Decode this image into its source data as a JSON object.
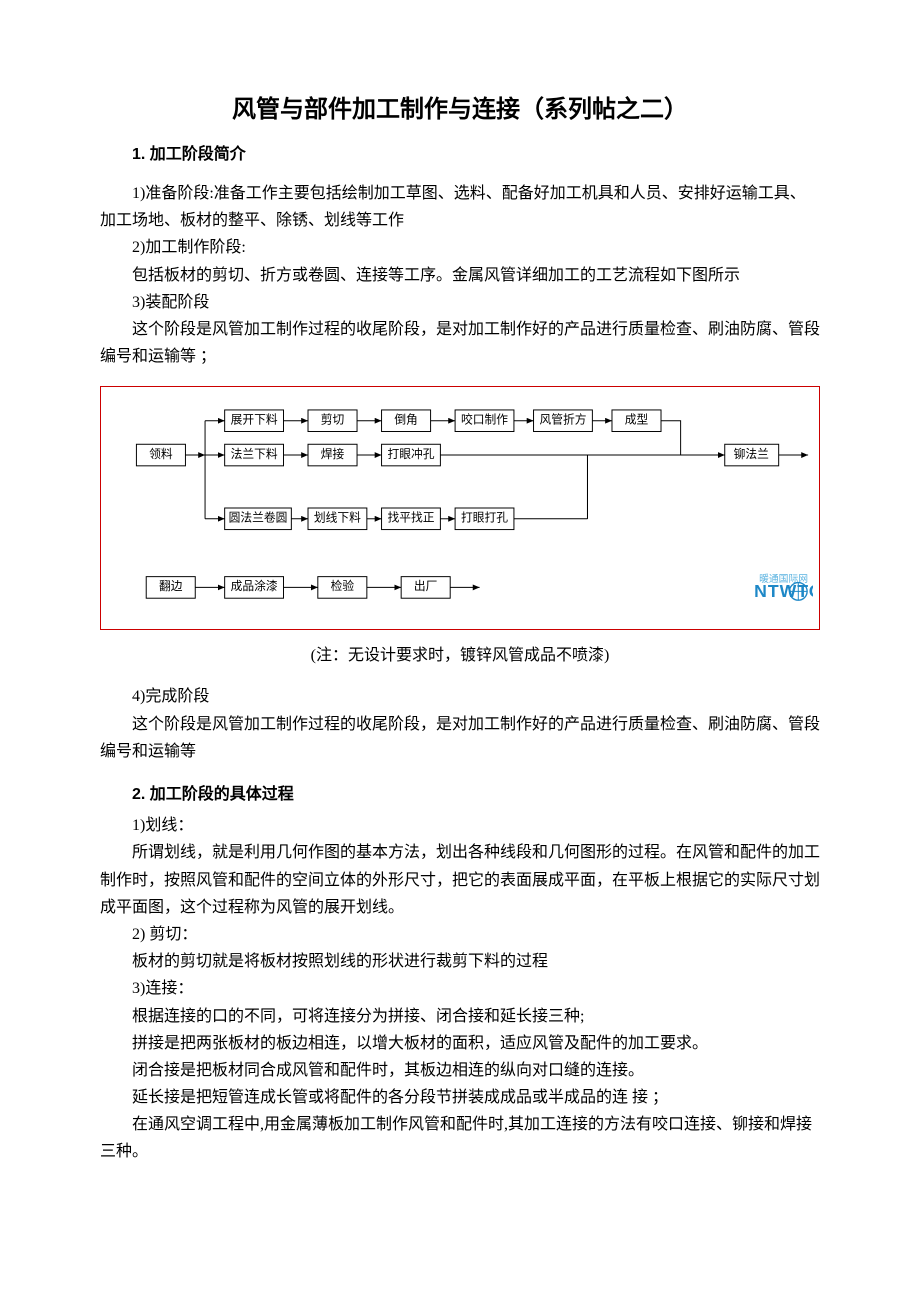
{
  "title": "风管与部件加工制作与连接（系列帖之二）",
  "s1": {
    "heading": "1. 加工阶段简介",
    "p1": "1)准备阶段:准备工作主要包括绘制加工草图、选料、配备好加工机具和人员、安排好运输工具、加工场地、板材的整平、除锈、划线等工作",
    "p2": "2)加工制作阶段:",
    "p3": "包括板材的剪切、折方或卷圆、连接等工序。金属风管详细加工的工艺流程如下图所示",
    "p4": "3)装配阶段",
    "p5": "这个阶段是风管加工制作过程的收尾阶段，是对加工制作好的产品进行质量检查、刷油防腐、管段编号和运输等  ；"
  },
  "flow": {
    "b1": "领料",
    "b2": "展开下料",
    "b3": "剪切",
    "b4": "倒角",
    "b5": "咬口制作",
    "b6": "风管折方",
    "b7": "成型",
    "b8": "法兰下料",
    "b9": "焊接",
    "b10": "打眼冲孔",
    "b11": "圆法兰卷圆",
    "b12": "划线下料",
    "b13": "找平找正",
    "b14": "打眼打孔",
    "b15": "铆法兰",
    "b16": "翻边",
    "b17": "成品涂漆",
    "b18": "检验",
    "b19": "出厂",
    "wm1": "暖通国际网",
    "wm2": "NTWTO"
  },
  "note": "(注：无设计要求时，镀锌风管成品不喷漆)",
  "s1b": {
    "p1": "4)完成阶段",
    "p2": "这个阶段是风管加工制作过程的收尾阶段，是对加工制作好的产品进行质量检查、刷油防腐、管段编号和运输等"
  },
  "s2": {
    "heading": "2. 加工阶段的具体过程",
    "p1": "1)划线：",
    "p2": "所谓划线，就是利用几何作图的基本方法，划出各种线段和几何图形的过程。在风管和配件的加工制作时，按照风管和配件的空间立体的外形尺寸，把它的表面展成平面，在平板上根据它的实际尺寸划成平面图，这个过程称为风管的展开划线。",
    "p3": "2)  剪切：",
    "p4": "板材的剪切就是将板材按照划线的形状进行裁剪下料的过程",
    "p5": "3)连接：",
    "p6": "根据连接的口的不同，可将连接分为拼接、闭合接和延长接三种;",
    "p7": "拼接是把两张板材的板边相连，以增大板材的面积，适应风管及配件的加工要求。",
    "p8": "闭合接是把板材同合成风管和配件时，其板边相连的纵向对口缝的连接。",
    "p9": "延长接是把短管连成长管或将配件的各分段节拼装成成品或半成品的连  接  ；",
    "p10": "在通风空调工程中,用金属薄板加工制作风管和配件时,其加工连接的方法有咬口连接、铆接和焊接三种。"
  }
}
